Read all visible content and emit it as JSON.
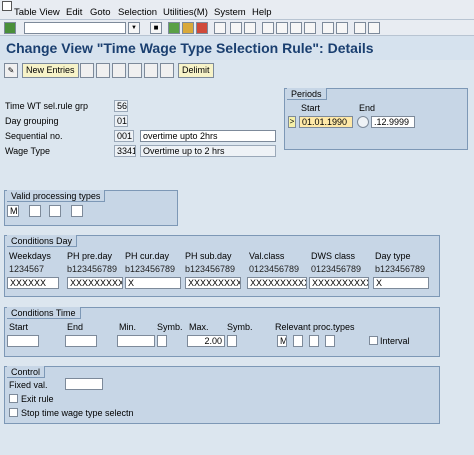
{
  "menu": [
    "Table View",
    "Edit",
    "Goto",
    "Selection",
    "Utilities(M)",
    "System",
    "Help"
  ],
  "title": "Change View \"Time Wage Type Selection Rule\": Details",
  "toolbar2": {
    "new_entries": "New Entries",
    "delimit": "Delimit"
  },
  "fields": {
    "time_wt_grp": {
      "label": "Time WT sel.rule grp",
      "value": "56"
    },
    "day_grouping": {
      "label": "Day grouping",
      "value": "01"
    },
    "seq_no": {
      "label": "Sequential no.",
      "value": "001",
      "text": "overtime upto 2hrs"
    },
    "wage_type": {
      "label": "Wage Type",
      "value": "3341",
      "text": "Overtime up to 2 hrs"
    }
  },
  "periods": {
    "title": "Periods",
    "start_label": "Start",
    "end_label": "End",
    "start": "01.01.1990",
    "end": ".12.9999"
  },
  "valid_proc": {
    "title": "Valid processing types",
    "values": [
      "M",
      "",
      "",
      ""
    ]
  },
  "conditions_day": {
    "title": "Conditions Day",
    "headers": [
      "Weekdays",
      "PH pre.day",
      "PH cur.day",
      "PH sub.day",
      "Val.class",
      "DWS class",
      "Day type"
    ],
    "subheaders": [
      "1234567",
      "b123456789",
      "b123456789",
      "b123456789",
      "0123456789",
      "0123456789",
      "b123456789"
    ],
    "values": [
      "XXXXXX",
      "XXXXXXXXXX",
      "X",
      "XXXXXXXXXX",
      "XXXXXXXXXX",
      "XXXXXXXXXX",
      "X"
    ]
  },
  "conditions_time": {
    "title": "Conditions Time",
    "headers": [
      "Start",
      "End",
      "Min.",
      "Symb.",
      "Max.",
      "Symb.",
      "Relevant proc.types"
    ],
    "max": "2.00",
    "proc_type": "M",
    "interval": "Interval"
  },
  "control": {
    "title": "Control",
    "fixed_val": "Fixed val.",
    "exit_rule": "Exit rule",
    "stop_rule": "Stop time wage type selectn"
  }
}
